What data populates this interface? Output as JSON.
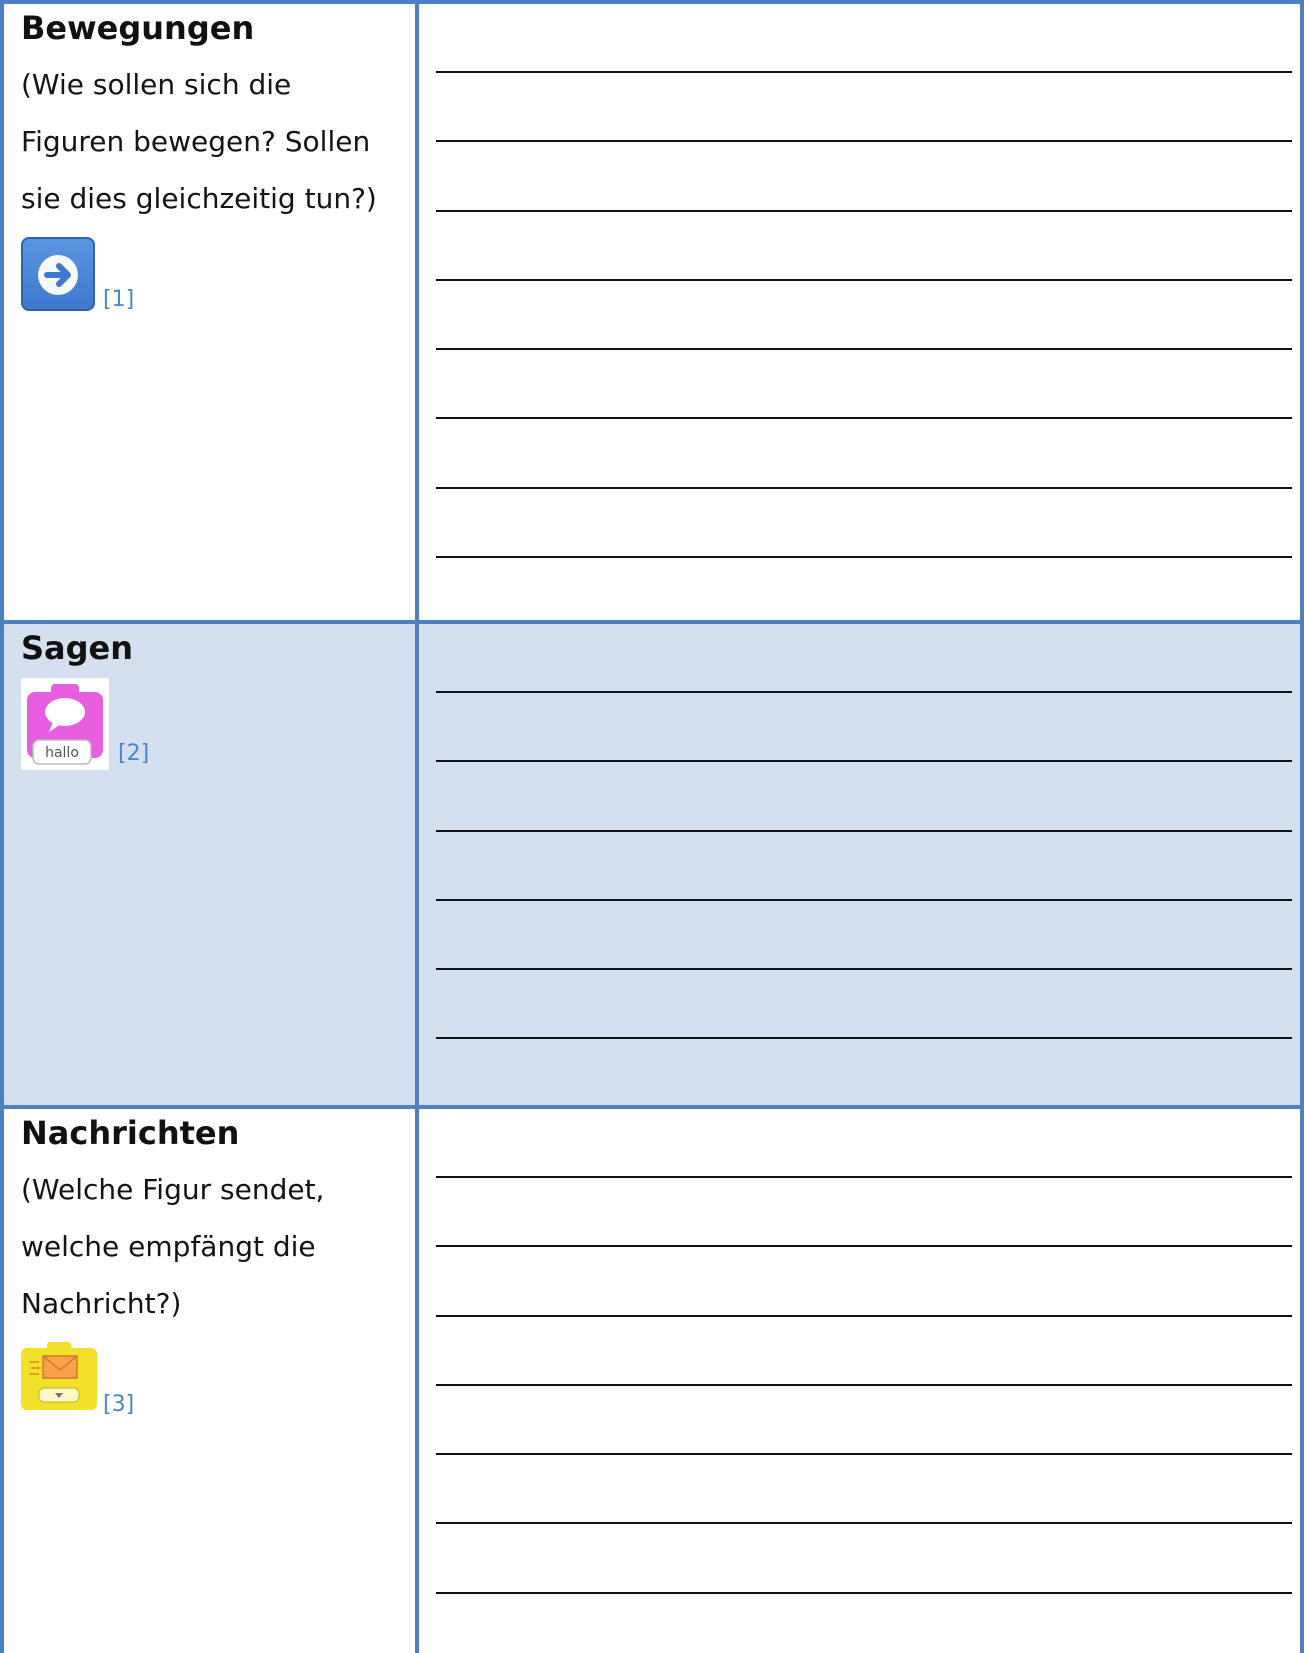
{
  "sections": [
    {
      "heading": "Bewegungen",
      "description_lines": [
        "(Wie sollen sich die",
        "Figuren bewegen? Sollen",
        "sie dies gleichzeitig tun?)"
      ],
      "icon": "arrow-right-block-icon",
      "reference": "[1]"
    },
    {
      "heading": "Sagen",
      "description_lines": [],
      "icon": "speech-bubble-block-icon",
      "icon_label": "hallo",
      "reference": "[2]"
    },
    {
      "heading": "Nachrichten",
      "description_lines": [
        "(Welche Figur sendet,",
        "welche empfängt die",
        "Nachricht?)"
      ],
      "icon": "envelope-message-block-icon",
      "reference": "[3]"
    }
  ],
  "colors": {
    "border": "#4f7fc0",
    "alt_row_background": "#d4e0ef",
    "reference_link": "#4a86c8",
    "move_block": "#4a86d9",
    "say_block": "#e75fe0",
    "message_block": "#f2e02a"
  }
}
